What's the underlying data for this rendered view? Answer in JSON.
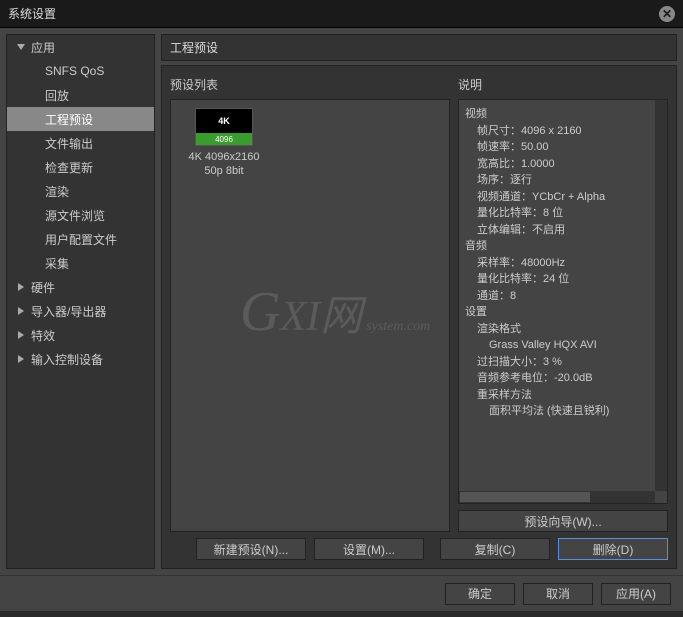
{
  "titlebar": {
    "title": "系统设置"
  },
  "sidebar": {
    "app": {
      "label": "应用",
      "expanded": true
    },
    "app_children": [
      {
        "label": "SNFS QoS"
      },
      {
        "label": "回放"
      },
      {
        "label": "工程预设",
        "selected": true
      },
      {
        "label": "文件输出"
      },
      {
        "label": "检查更新"
      },
      {
        "label": "渲染"
      },
      {
        "label": "源文件浏览"
      },
      {
        "label": "用户配置文件"
      },
      {
        "label": "采集"
      }
    ],
    "hardware": {
      "label": "硬件"
    },
    "importer": {
      "label": "导入器/导出器"
    },
    "effects": {
      "label": "特效"
    },
    "input_ctrl": {
      "label": "输入控制设备"
    }
  },
  "main": {
    "section_title": "工程预设",
    "preset_list_label": "预设列表",
    "desc_label": "说明",
    "preset": {
      "badge": "4K",
      "thumb_label": "4096",
      "name_line1": "4K 4096x2160",
      "name_line2": "50p 8bit"
    },
    "desc": {
      "video": "视频",
      "frame_size": "帧尺寸：4096 x 2160",
      "frame_rate": "帧速率：50.00",
      "aspect": "宽高比：1.0000",
      "field_order": "场序：逐行",
      "video_channel": "视频通道：YCbCr + Alpha",
      "quant_bitrate_v": "量化比特率：8 位",
      "stereo_edit": "立体编辑：不启用",
      "audio": "音频",
      "sample_rate": "采样率：48000Hz",
      "quant_bitrate_a": "量化比特率：24 位",
      "channels": "通道：8",
      "settings": "设置",
      "render_format": "渲染格式",
      "render_codec": "Grass Valley HQX AVI",
      "overscan": "过扫描大小：3 %",
      "audio_ref": "音频参考电位：-20.0dB",
      "resample": "重采样方法",
      "resample_method": "面积平均法 (快速且锐利)"
    },
    "wizard_btn": "预设向导(W)...",
    "new_btn": "新建预设(N)...",
    "settings_btn": "设置(M)...",
    "copy_btn": "复制(C)",
    "delete_btn": "删除(D)"
  },
  "footer": {
    "ok": "确定",
    "cancel": "取消",
    "apply": "应用(A)"
  },
  "watermark": {
    "g": "G",
    "xi": "XI",
    "net": "网",
    "sys": "system.com"
  }
}
